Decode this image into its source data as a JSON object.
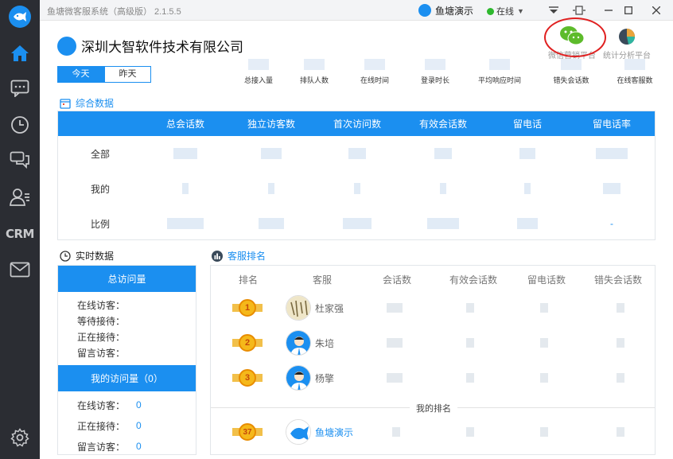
{
  "window": {
    "title": "鱼塘微客服系统（高级版） 2.1.5.5",
    "user_name": "鱼塘演示",
    "status": "在线",
    "status_color": "#2eb82e"
  },
  "sidebar": {
    "items": [
      {
        "icon": "home-icon"
      },
      {
        "icon": "chat-icon"
      },
      {
        "icon": "clock-icon"
      },
      {
        "icon": "conversation-icon"
      },
      {
        "icon": "contacts-icon"
      },
      {
        "icon": "crm-icon",
        "label": "CRM"
      },
      {
        "icon": "mail-icon"
      },
      {
        "icon": "settings-icon"
      }
    ]
  },
  "header": {
    "company": "深圳大智软件技术有限公司",
    "platforms": [
      {
        "label": "微信营销平台",
        "icon": "wechat-icon"
      },
      {
        "label": "统计分析平台",
        "icon": "pie-chart-icon"
      }
    ],
    "tabs": [
      "今天",
      "昨天"
    ],
    "kpis": [
      "总接入量",
      "排队人数",
      "在线时间",
      "登录时长",
      "平均响应时间",
      "错失会话数",
      "在线客服数"
    ]
  },
  "composite": {
    "title": "综合数据",
    "columns": [
      "总会话数",
      "独立访客数",
      "首次访问数",
      "有效会话数",
      "留电话",
      "留电话率"
    ],
    "rows": [
      {
        "label": "全部"
      },
      {
        "label": "我的"
      },
      {
        "label": "比例",
        "last": "-"
      }
    ]
  },
  "realtime": {
    "title": "实时数据",
    "total_label": "总访问量",
    "total_lines": [
      "在线访客：",
      "等待接待：",
      "正在接待：",
      "留言访客："
    ],
    "mine_label": "我的访问量（0）",
    "mine_lines": [
      {
        "label": "在线访客：",
        "value": "0"
      },
      {
        "label": "正在接待：",
        "value": "0"
      },
      {
        "label": "留言访客：",
        "value": "0"
      }
    ]
  },
  "ranking": {
    "title": "客服排名",
    "columns": [
      "排名",
      "客服",
      "会话数",
      "有效会话数",
      "留电话数",
      "错失会话数"
    ],
    "rows": [
      {
        "rank": "1",
        "name": "杜家强"
      },
      {
        "rank": "2",
        "name": "朱培"
      },
      {
        "rank": "3",
        "name": "杨擎"
      }
    ],
    "my_rank_label": "我的排名",
    "mine": {
      "rank": "37",
      "name": "鱼塘演示"
    }
  },
  "colors": {
    "accent": "#1b8ff0",
    "sidebar": "#2b2d33",
    "highlight_ring": "#e02020"
  }
}
